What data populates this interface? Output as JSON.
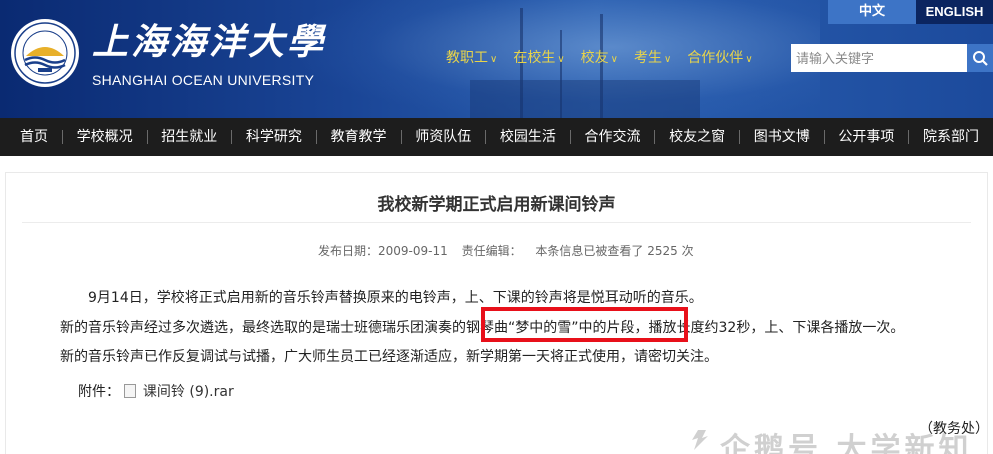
{
  "header": {
    "brand_cn": "上海海洋大學",
    "brand_en": "SHANGHAI OCEAN UNIVERSITY",
    "lang_cn": "中文",
    "lang_en": "ENGLISH",
    "quick_nav": [
      "教职工",
      "在校生",
      "校友",
      "考生",
      "合作伙伴"
    ],
    "search_placeholder": "请输入关键字",
    "colors": {
      "header_blue": "#1a4596",
      "accent_blue": "#3d74c6",
      "quick_nav_yellow": "#e8d44a",
      "nav_dark": "#1d1d1d"
    }
  },
  "main_nav": [
    "首页",
    "学校概况",
    "招生就业",
    "科学研究",
    "教育教学",
    "师资队伍",
    "校园生活",
    "合作交流",
    "校友之窗",
    "图书文博",
    "公开事项",
    "院系部门"
  ],
  "article": {
    "title": "我校新学期正式启用新课间铃声",
    "publish_date": "发布日期：2009-09-11",
    "editor": "责任编辑：",
    "views": "本条信息已被查看了  2525  次",
    "para1": "9月14日，学校将正式启用新的音乐铃声替换原来的电铃声，上、下课的铃声将是悦耳动听的音乐。",
    "para2": "新的音乐铃声经过多次遴选，最终选取的是瑞士班德瑞乐团演奏的钢琴曲“梦中的雪”中的片段，播放长度约32秒，上、下课各播放一次。",
    "para3": "新的音乐铃声已作反复调试与试播，广大师生员工已经逐渐适应，新学期第一天将正式使用，请密切关注。",
    "attachment_label": "附件：",
    "attachment_name": "课间铃 (9).rar",
    "signoff": "（教务处）",
    "highlight_color": "#e8101a"
  },
  "watermark": "企鹅号 大学新知"
}
